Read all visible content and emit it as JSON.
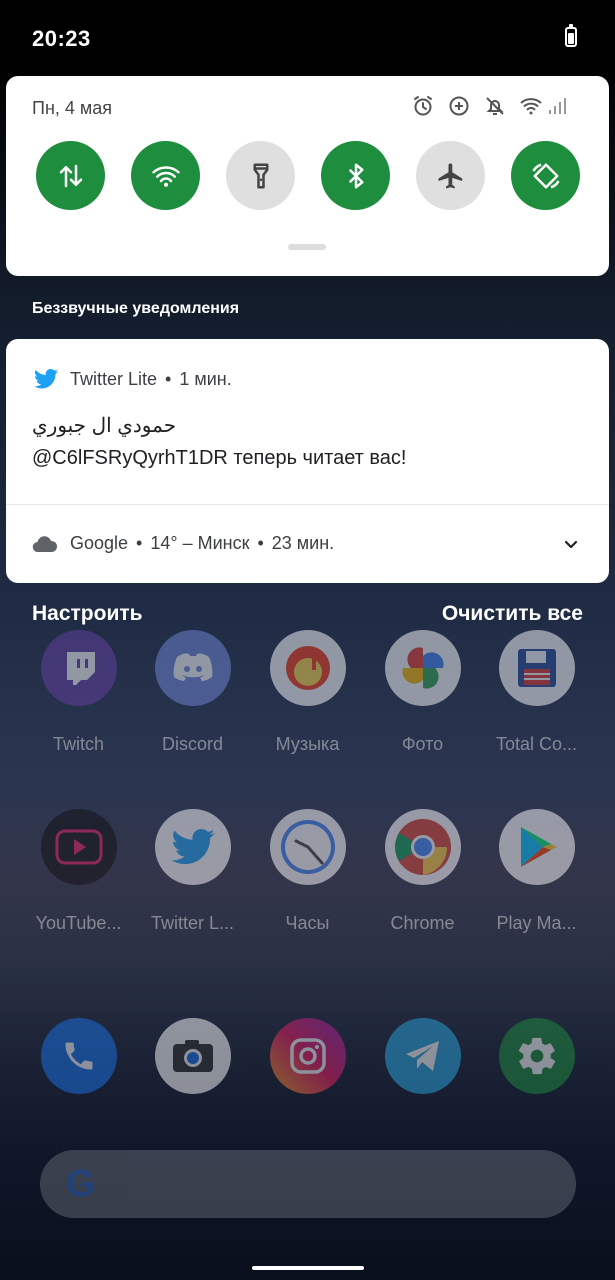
{
  "status_bar": {
    "time": "20:23",
    "battery_icon": "battery-icon"
  },
  "quick_settings": {
    "date": "Пн, 4 мая",
    "status_icons": [
      "alarm-icon",
      "data-saver-icon",
      "notifications-off-icon",
      "wifi-signal-icon",
      "cell-signal-icon"
    ],
    "tiles": [
      {
        "name": "mobile-data",
        "icon": "data-arrows-icon",
        "state": "on"
      },
      {
        "name": "wifi",
        "icon": "wifi-icon",
        "state": "on"
      },
      {
        "name": "flashlight",
        "icon": "flashlight-icon",
        "state": "off"
      },
      {
        "name": "bluetooth",
        "icon": "bluetooth-icon",
        "state": "on"
      },
      {
        "name": "airplane-mode",
        "icon": "airplane-icon",
        "state": "off"
      },
      {
        "name": "auto-rotate",
        "icon": "rotate-icon",
        "state": "on"
      }
    ],
    "active_color": "#1e8e3e",
    "inactive_color": "#dfdfdf"
  },
  "section_header": "Беззвучные уведомления",
  "notification": {
    "app": "Twitter Lite",
    "separator": "•",
    "time": "1 мин.",
    "title": "حمودي ال جبوري",
    "text": "@C6lFSRyQyrhT1DR теперь читает вас!",
    "brand_color": "#1da1f2"
  },
  "weather_notification": {
    "app": "Google",
    "separator": "•",
    "summary": "14° – Минск",
    "time": "23 мин."
  },
  "footer": {
    "settings": "Настроить",
    "clear_all": "Очистить все"
  },
  "apps_row1": [
    "Twitch",
    "Discord",
    "Музыка",
    "Фото",
    "Total Co..."
  ],
  "apps_row2": [
    "YouTube...",
    "Twitter L...",
    "Часы",
    "Chrome",
    "Play Ma..."
  ],
  "dock": [
    "phone-icon",
    "camera-icon",
    "instagram-icon",
    "telegram-icon",
    "settings-icon"
  ],
  "search": {
    "logo": "G"
  }
}
